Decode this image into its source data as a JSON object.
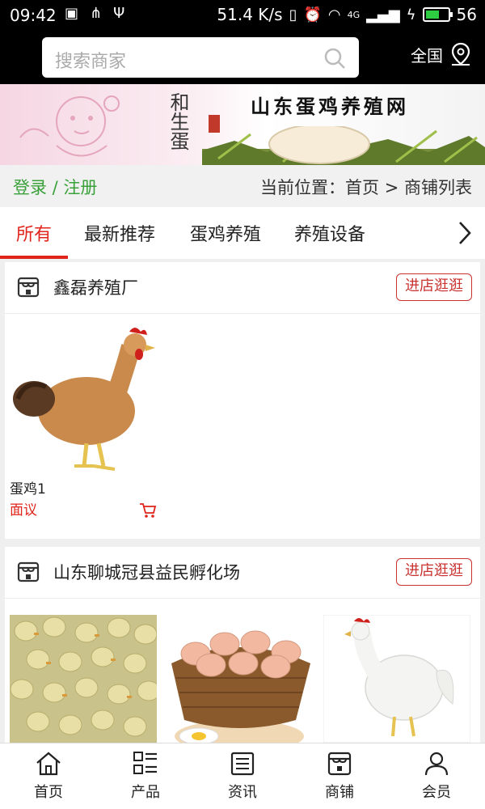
{
  "status_bar": {
    "time": "09:42",
    "net_speed": "51.4 K/s",
    "signal_label": "4G",
    "battery_level": "56"
  },
  "search": {
    "placeholder": "搜索商家",
    "region": "全国"
  },
  "banner": {
    "brand": "和生蛋",
    "title": "山东蛋鸡养殖网"
  },
  "location_bar": {
    "login": "登录 / 注册",
    "breadcrumb": "当前位置：首页 > 商铺列表"
  },
  "tabs": [
    {
      "label": "所有",
      "active": true
    },
    {
      "label": "最新推荐"
    },
    {
      "label": "蛋鸡养殖"
    },
    {
      "label": "养殖设备"
    }
  ],
  "shops": [
    {
      "name": "鑫磊养殖厂",
      "visit_label": "进店逛逛",
      "products": [
        {
          "name": "蛋鸡1",
          "price": "面议"
        }
      ]
    },
    {
      "name": "山东聊城冠县益民孵化场",
      "visit_label": "进店逛逛",
      "products": [
        {
          "image": "ducklings"
        },
        {
          "image": "eggs-basket"
        },
        {
          "image": "white-hen"
        }
      ]
    }
  ],
  "bottom_nav": [
    {
      "label": "首页",
      "icon": "home-icon"
    },
    {
      "label": "产品",
      "icon": "grid-icon"
    },
    {
      "label": "资讯",
      "icon": "news-icon"
    },
    {
      "label": "商铺",
      "icon": "store-icon"
    },
    {
      "label": "会员",
      "icon": "user-icon"
    }
  ],
  "colors": {
    "accent": "#e0241b",
    "login_green": "#3aa13a"
  }
}
